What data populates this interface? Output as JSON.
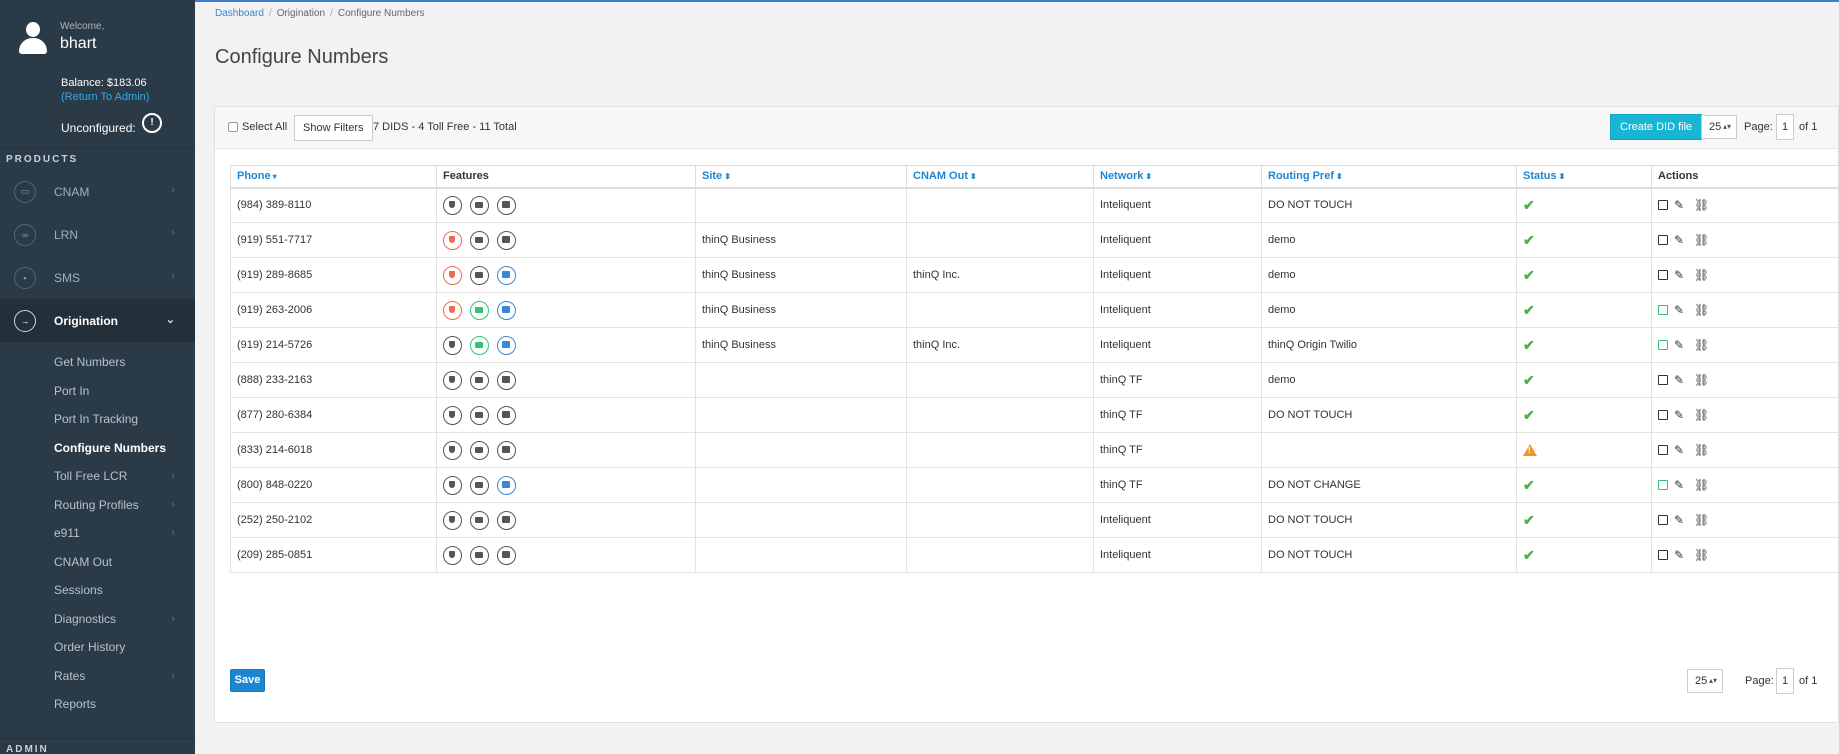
{
  "user": {
    "welcome": "Welcome,",
    "name": "bhart",
    "balance": "Balance: $183.06",
    "return_admin": "(Return To Admin)",
    "unconfigured": "Unconfigured:",
    "unconfigured_icon": "alert-icon"
  },
  "sidebar": {
    "products_label": "PRODUCTS",
    "items": [
      {
        "label": "CNAM",
        "icon": "cnam-icon"
      },
      {
        "label": "LRN",
        "icon": "lrn-icon"
      },
      {
        "label": "SMS",
        "icon": "sms-icon"
      },
      {
        "label": "Origination",
        "icon": "origination-icon"
      }
    ],
    "sub_items": [
      {
        "label": "Get Numbers"
      },
      {
        "label": "Port In"
      },
      {
        "label": "Port In Tracking"
      },
      {
        "label": "Configure Numbers"
      },
      {
        "label": "Toll Free LCR"
      },
      {
        "label": "Routing Profiles"
      },
      {
        "label": "e911"
      },
      {
        "label": "CNAM Out"
      },
      {
        "label": "Sessions"
      },
      {
        "label": "Diagnostics"
      },
      {
        "label": "Order History"
      },
      {
        "label": "Rates"
      },
      {
        "label": "Reports"
      }
    ],
    "admin_label": "ADMIN"
  },
  "breadcrumb": {
    "items": [
      "Dashboard",
      "Origination",
      "Configure Numbers"
    ],
    "separator": "/"
  },
  "page_title": "Configure Numbers",
  "toolbar": {
    "select_all": "Select All",
    "show_filters": "Show Filters",
    "summary": "7 DIDS - 4 Toll Free - 11 Total",
    "create_did": "Create DID file",
    "per_page": "25",
    "page_label": "Page:",
    "page_value": "1",
    "of_label": "of 1"
  },
  "table": {
    "headers": {
      "phone": "Phone",
      "features": "Features",
      "site": "Site",
      "cnam_out": "CNAM Out",
      "network": "Network",
      "routing_pref": "Routing Pref",
      "status": "Status",
      "actions": "Actions"
    },
    "rows": [
      {
        "phone": "(984) 389-8110",
        "f": [
          "dark",
          "dark",
          "dark"
        ],
        "site": "",
        "cnam": "",
        "network": "Inteliquent",
        "routing": "DO NOT TOUCH",
        "status": "ok",
        "note": "dark"
      },
      {
        "phone": "(919) 551-7717",
        "f": [
          "red",
          "dark",
          "dark"
        ],
        "site": "thinQ Business",
        "cnam": "",
        "network": "Inteliquent",
        "routing": "demo",
        "status": "ok",
        "note": "dark"
      },
      {
        "phone": "(919) 289-8685",
        "f": [
          "red",
          "dark",
          "blue"
        ],
        "site": "thinQ Business",
        "cnam": "thinQ Inc.",
        "network": "Inteliquent",
        "routing": "demo",
        "status": "ok",
        "note": "dark"
      },
      {
        "phone": "(919) 263-2006",
        "f": [
          "red",
          "green",
          "blue"
        ],
        "site": "thinQ Business",
        "cnam": "",
        "network": "Inteliquent",
        "routing": "demo",
        "status": "ok",
        "note": "green"
      },
      {
        "phone": "(919) 214-5726",
        "f": [
          "dark",
          "green",
          "blue"
        ],
        "site": "thinQ Business",
        "cnam": "thinQ Inc.",
        "network": "Inteliquent",
        "routing": "thinQ Origin Twilio",
        "status": "ok",
        "note": "green"
      },
      {
        "phone": "(888) 233-2163",
        "f": [
          "dark",
          "dark",
          "dark"
        ],
        "site": "",
        "cnam": "",
        "network": "thinQ TF",
        "routing": "demo",
        "status": "ok",
        "note": "dark"
      },
      {
        "phone": "(877) 280-6384",
        "f": [
          "dark",
          "dark",
          "dark"
        ],
        "site": "",
        "cnam": "",
        "network": "thinQ TF",
        "routing": "DO NOT TOUCH",
        "status": "ok",
        "note": "dark"
      },
      {
        "phone": "(833) 214-6018",
        "f": [
          "dark",
          "dark",
          "dark"
        ],
        "site": "",
        "cnam": "",
        "network": "thinQ TF",
        "routing": "",
        "status": "warning",
        "note": "dark"
      },
      {
        "phone": "(800) 848-0220",
        "f": [
          "dark",
          "dark",
          "blue"
        ],
        "site": "",
        "cnam": "",
        "network": "thinQ TF",
        "routing": "DO NOT CHANGE",
        "status": "ok",
        "note": "green"
      },
      {
        "phone": "(252) 250-2102",
        "f": [
          "dark",
          "dark",
          "dark"
        ],
        "site": "",
        "cnam": "",
        "network": "Inteliquent",
        "routing": "DO NOT TOUCH",
        "status": "ok",
        "note": "dark"
      },
      {
        "phone": "(209) 285-0851",
        "f": [
          "dark",
          "dark",
          "dark"
        ],
        "site": "",
        "cnam": "",
        "network": "Inteliquent",
        "routing": "DO NOT TOUCH",
        "status": "ok",
        "note": "dark"
      }
    ]
  },
  "footer": {
    "save": "Save",
    "per_page": "25",
    "page_label": "Page:",
    "page_value": "1",
    "of_label": "of 1"
  },
  "colors": {
    "sidebar_bg": "#2b3a47",
    "accent": "#1b87d4",
    "create_button": "#18b6d4",
    "ok": "#4cb04c",
    "warning": "#f0952e"
  }
}
